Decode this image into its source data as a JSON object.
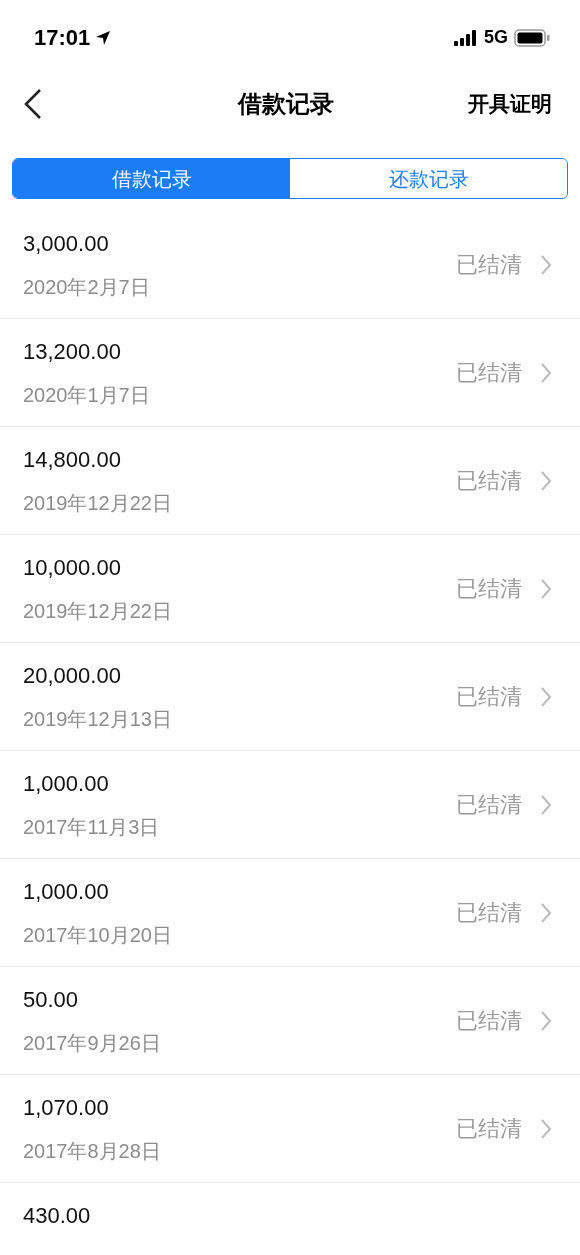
{
  "status_bar": {
    "time": "17:01",
    "network": "5G"
  },
  "nav": {
    "title": "借款记录",
    "action": "开具证明"
  },
  "tabs": [
    {
      "label": "借款记录",
      "selected": true
    },
    {
      "label": "还款记录",
      "selected": false
    }
  ],
  "records": [
    {
      "amount": "3,000.00",
      "date": "2020年2月7日",
      "status": "已结清"
    },
    {
      "amount": "13,200.00",
      "date": "2020年1月7日",
      "status": "已结清"
    },
    {
      "amount": "14,800.00",
      "date": "2019年12月22日",
      "status": "已结清"
    },
    {
      "amount": "10,000.00",
      "date": "2019年12月22日",
      "status": "已结清"
    },
    {
      "amount": "20,000.00",
      "date": "2019年12月13日",
      "status": "已结清"
    },
    {
      "amount": "1,000.00",
      "date": "2017年11月3日",
      "status": "已结清"
    },
    {
      "amount": "1,000.00",
      "date": "2017年10月20日",
      "status": "已结清"
    },
    {
      "amount": "50.00",
      "date": "2017年9月26日",
      "status": "已结清"
    },
    {
      "amount": "1,070.00",
      "date": "2017年8月28日",
      "status": "已结清"
    },
    {
      "amount": "430.00"
    }
  ]
}
